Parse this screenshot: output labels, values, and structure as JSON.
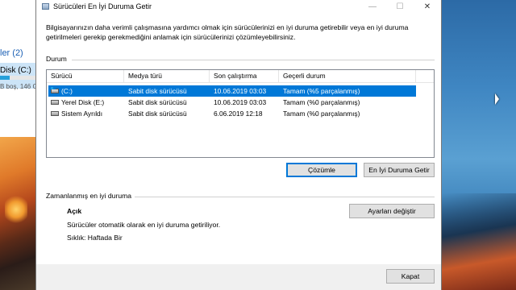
{
  "background": {
    "left_panel": {
      "section_label": "ler (2)",
      "drive_label": "Disk (C:)",
      "free_text": "B boş, 146 G"
    }
  },
  "window": {
    "title": "Sürücüleri En İyi Duruma Getir",
    "controls": {
      "minimize": "—",
      "maximize": "☐",
      "close": "✕"
    },
    "intro_text": "Bilgisayarınızın daha verimli çalışmasına yardımcı olmak için sürücülerinizi en iyi duruma getirebilir veya en iyi duruma getirilmeleri gerekip gerekmediğini anlamak için sürücülerinizi çözümleyebilirsiniz.",
    "status_group": {
      "label": "Durum",
      "columns": [
        "Sürücü",
        "Medya türü",
        "Son çalıştırma",
        "Geçerli durum"
      ],
      "rows": [
        {
          "drive": "(C:)",
          "media": "Sabit disk sürücüsü",
          "last_run": "10.06.2019 03:03",
          "status": "Tamam (%5 parçalanmış)",
          "icon": "windows-drive-icon",
          "selected": true
        },
        {
          "drive": "Yerel Disk (E:)",
          "media": "Sabit disk sürücüsü",
          "last_run": "10.06.2019 03:03",
          "status": "Tamam (%0 parçalanmış)",
          "icon": "hard-drive-icon",
          "selected": false
        },
        {
          "drive": "Sistem Ayrıldı",
          "media": "Sabit disk sürücüsü",
          "last_run": "6.06.2019 12:18",
          "status": "Tamam (%0 parçalanmış)",
          "icon": "hard-drive-icon",
          "selected": false
        }
      ],
      "analyze_button": "Çözümle",
      "optimize_button": "En İyi Duruma Getir"
    },
    "schedule_group": {
      "label": "Zamanlanmış en iyi duruma",
      "status": "Açık",
      "description": "Sürücüler otomatik olarak en iyi duruma getiriliyor.",
      "frequency": "Sıklık: Haftada Bir",
      "change_settings_button": "Ayarları değiştir"
    },
    "close_button": "Kapat"
  },
  "colors": {
    "selection": "#0078d7",
    "dialog_bg": "#f0f0f0"
  }
}
